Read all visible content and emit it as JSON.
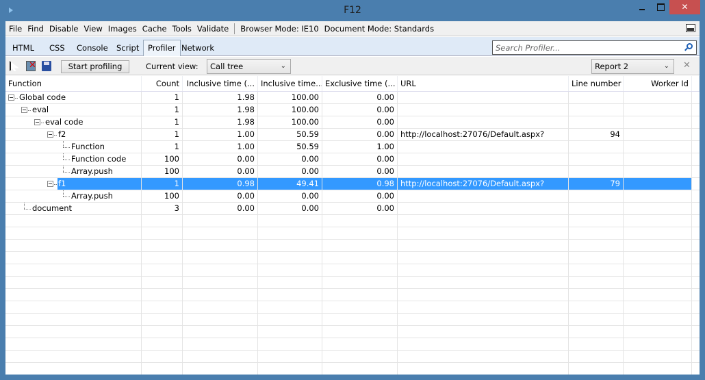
{
  "window": {
    "title": "F12",
    "close": "✕"
  },
  "menu": {
    "items": [
      "File",
      "Find",
      "Disable",
      "View",
      "Images",
      "Cache",
      "Tools",
      "Validate"
    ],
    "browser_mode": "Browser Mode:  IE10",
    "document_mode": "Document Mode:  Standards"
  },
  "tabs": [
    "HTML",
    "CSS",
    "Console",
    "Script",
    "Profiler",
    "Network"
  ],
  "active_tab": "Profiler",
  "search": {
    "placeholder": "Search Profiler..."
  },
  "toolbar": {
    "start_label": "Start profiling",
    "current_view_label": "Current view:",
    "current_view": "Call tree",
    "report": "Report 2",
    "close": "✕"
  },
  "table": {
    "columns": [
      "Function",
      "Count",
      "Inclusive time (...",
      "Inclusive time...",
      "Exclusive time (...",
      "URL",
      "Line number",
      "Worker Id"
    ],
    "rows": [
      {
        "name": "Global code",
        "depth": 0,
        "expandable": true,
        "count": "1",
        "incl_ms": "1.98",
        "incl_pct": "100.00",
        "excl": "0.00",
        "url": "",
        "line": "",
        "worker": ""
      },
      {
        "name": "eval",
        "depth": 1,
        "expandable": true,
        "count": "1",
        "incl_ms": "1.98",
        "incl_pct": "100.00",
        "excl": "0.00",
        "url": "",
        "line": "",
        "worker": ""
      },
      {
        "name": "eval code",
        "depth": 2,
        "expandable": true,
        "count": "1",
        "incl_ms": "1.98",
        "incl_pct": "100.00",
        "excl": "0.00",
        "url": "",
        "line": "",
        "worker": ""
      },
      {
        "name": "f2",
        "depth": 3,
        "expandable": true,
        "count": "1",
        "incl_ms": "1.00",
        "incl_pct": "50.59",
        "excl": "0.00",
        "url": "http://localhost:27076/Default.aspx?",
        "line": "94",
        "worker": ""
      },
      {
        "name": "Function",
        "depth": 4,
        "expandable": false,
        "count": "1",
        "incl_ms": "1.00",
        "incl_pct": "50.59",
        "excl": "1.00",
        "url": "",
        "line": "",
        "worker": ""
      },
      {
        "name": "Function code",
        "depth": 4,
        "expandable": false,
        "count": "100",
        "incl_ms": "0.00",
        "incl_pct": "0.00",
        "excl": "0.00",
        "url": "",
        "line": "",
        "worker": ""
      },
      {
        "name": "Array.push",
        "depth": 4,
        "expandable": false,
        "count": "100",
        "incl_ms": "0.00",
        "incl_pct": "0.00",
        "excl": "0.00",
        "url": "",
        "line": "",
        "worker": ""
      },
      {
        "name": "f1",
        "depth": 3,
        "expandable": true,
        "selected": true,
        "count": "1",
        "incl_ms": "0.98",
        "incl_pct": "49.41",
        "excl": "0.98",
        "url": "http://localhost:27076/Default.aspx?",
        "line": "79",
        "worker": ""
      },
      {
        "name": "Array.push",
        "depth": 4,
        "expandable": false,
        "count": "100",
        "incl_ms": "0.00",
        "incl_pct": "0.00",
        "excl": "0.00",
        "url": "",
        "line": "",
        "worker": ""
      },
      {
        "name": "document",
        "depth": 1,
        "expandable": false,
        "count": "3",
        "incl_ms": "0.00",
        "incl_pct": "0.00",
        "excl": "0.00",
        "url": "",
        "line": "",
        "worker": ""
      }
    ]
  },
  "colors": {
    "selection": "#3399ff",
    "titlebar": "#4a7eae",
    "close_button": "#c75050"
  }
}
